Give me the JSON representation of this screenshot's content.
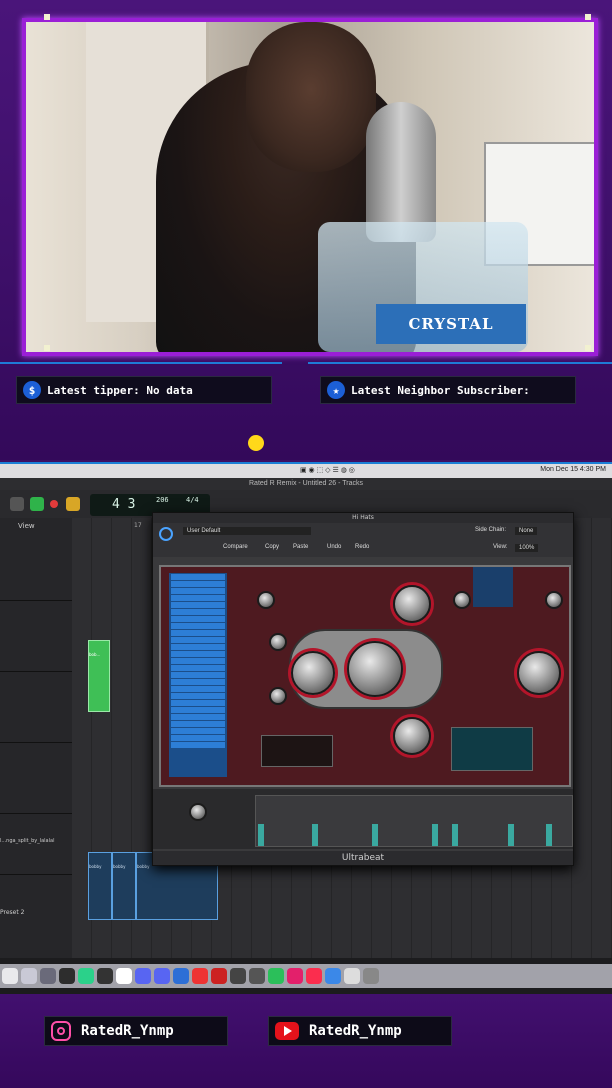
{
  "overlay": {
    "tipper_label": "Latest tipper: No data",
    "subscriber_label": "Latest Neighbor Subscriber:",
    "bottle_text": "CRYSTAL GEYSER"
  },
  "daw": {
    "window_title": "Rated R Remix - Untitled 26 - Tracks",
    "clock": "Mon Dec 15  4:30 PM",
    "lcd_position": "4 3",
    "tempo": "206",
    "signature": "4/4",
    "view_label": "View",
    "ruler_mark": "17",
    "track_names": [
      "l...nga_split_by_lalalal",
      "Preset 2"
    ],
    "audio_region_labels": [
      "bobby",
      "bobby",
      "bobby"
    ],
    "region_label": "bob..."
  },
  "plugin": {
    "title": "Hi Hats",
    "preset": "User Default",
    "compare": "Compare",
    "copy": "Copy",
    "paste": "Paste",
    "undo": "Undo",
    "redo": "Redo",
    "side_chain_label": "Side Chain:",
    "side_chain_value": "None",
    "view_label": "View:",
    "view_value": "100%",
    "name": "Ultrabeat"
  },
  "socials": {
    "instagram": "RatedR_Ynmp",
    "youtube": "RatedR_Ynmp"
  },
  "colors": {
    "frame": "#9a1fd6",
    "accent_blue": "#1b7fd6",
    "background": "#3c0f63"
  }
}
